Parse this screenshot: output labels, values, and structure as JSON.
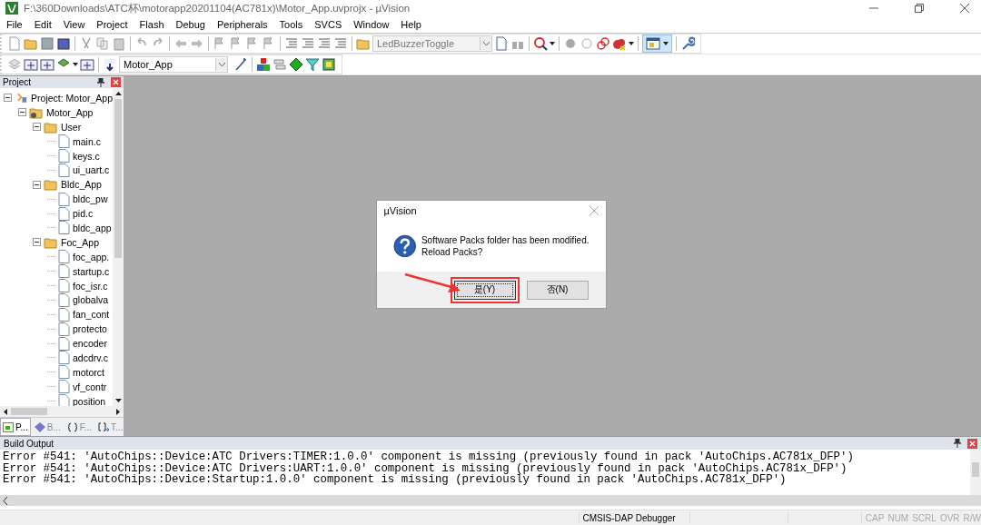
{
  "window": {
    "title": "F:\\360Downloads\\ATC杯\\motorapp20201104(AC781x)\\Motor_App.uvprojx - µVision"
  },
  "menu": [
    "File",
    "Edit",
    "View",
    "Project",
    "Flash",
    "Debug",
    "Peripherals",
    "Tools",
    "SVCS",
    "Window",
    "Help"
  ],
  "toolbar": {
    "function_combo": "LedBuzzerToggle",
    "target_combo": "Motor_App",
    "layout_button_pressed": true
  },
  "project_panel": {
    "title": "Project",
    "tree": [
      {
        "label": "Project: Motor_App",
        "kind": "project",
        "expanded": true,
        "children": [
          {
            "label": "Motor_App",
            "kind": "target",
            "expanded": true,
            "children": [
              {
                "label": "User",
                "kind": "folder",
                "expanded": true,
                "children": [
                  {
                    "label": "main.c",
                    "kind": "file"
                  },
                  {
                    "label": "keys.c",
                    "kind": "file"
                  },
                  {
                    "label": "ui_uart.c",
                    "kind": "file"
                  }
                ]
              },
              {
                "label": "Bldc_App",
                "kind": "folder",
                "expanded": true,
                "children": [
                  {
                    "label": "bldc_pw",
                    "kind": "file"
                  },
                  {
                    "label": "pid.c",
                    "kind": "file"
                  },
                  {
                    "label": "bldc_app",
                    "kind": "file"
                  }
                ]
              },
              {
                "label": "Foc_App",
                "kind": "folder",
                "expanded": true,
                "children": [
                  {
                    "label": "foc_app.",
                    "kind": "file"
                  },
                  {
                    "label": "startup.c",
                    "kind": "file"
                  },
                  {
                    "label": "foc_isr.c",
                    "kind": "file"
                  },
                  {
                    "label": "globalva",
                    "kind": "file"
                  },
                  {
                    "label": "fan_cont",
                    "kind": "file"
                  },
                  {
                    "label": "protecto",
                    "kind": "file"
                  },
                  {
                    "label": "encoder",
                    "kind": "file"
                  },
                  {
                    "label": "adcdrv.c",
                    "kind": "file"
                  },
                  {
                    "label": "motorct",
                    "kind": "file"
                  },
                  {
                    "label": "vf_contr",
                    "kind": "file"
                  },
                  {
                    "label": "position",
                    "kind": "file"
                  }
                ]
              }
            ]
          }
        ]
      }
    ],
    "tabs": [
      {
        "label": "P...",
        "kind": "project",
        "selected": true
      },
      {
        "label": "B...",
        "kind": "books",
        "selected": false
      },
      {
        "label": "F...",
        "kind": "functions",
        "selected": false
      },
      {
        "label": "T...",
        "kind": "templates",
        "selected": false
      }
    ]
  },
  "dialog": {
    "title": "µVision",
    "message": [
      "Software Packs folder has been modified.",
      "Reload Packs?"
    ],
    "buttons": [
      {
        "label": "是(Y)",
        "selected": true,
        "highlighted": true
      },
      {
        "label": "否(N)",
        "selected": false,
        "highlighted": false
      }
    ]
  },
  "build_output": {
    "title": "Build Output",
    "lines": [
      "Error #541: 'AutoChips::Device:ATC Drivers:TIMER:1.0.0' component is missing (previously found in pack 'AutoChips.AC781x_DFP')",
      "Error #541: 'AutoChips::Device:ATC Drivers:UART:1.0.0' component is missing (previously found in pack 'AutoChips.AC781x_DFP')",
      "Error #541: 'AutoChips::Device:Startup:1.0.0' component is missing (previously found in pack 'AutoChips.AC781x_DFP')"
    ]
  },
  "status_bar": {
    "debugger": "CMSIS-DAP Debugger",
    "indicators": [
      {
        "label": "CAP",
        "on": false
      },
      {
        "label": "NUM",
        "on": false
      },
      {
        "label": "SCRL",
        "on": false
      },
      {
        "label": "OVR",
        "on": false
      },
      {
        "label": "R/W",
        "on": false
      }
    ]
  }
}
